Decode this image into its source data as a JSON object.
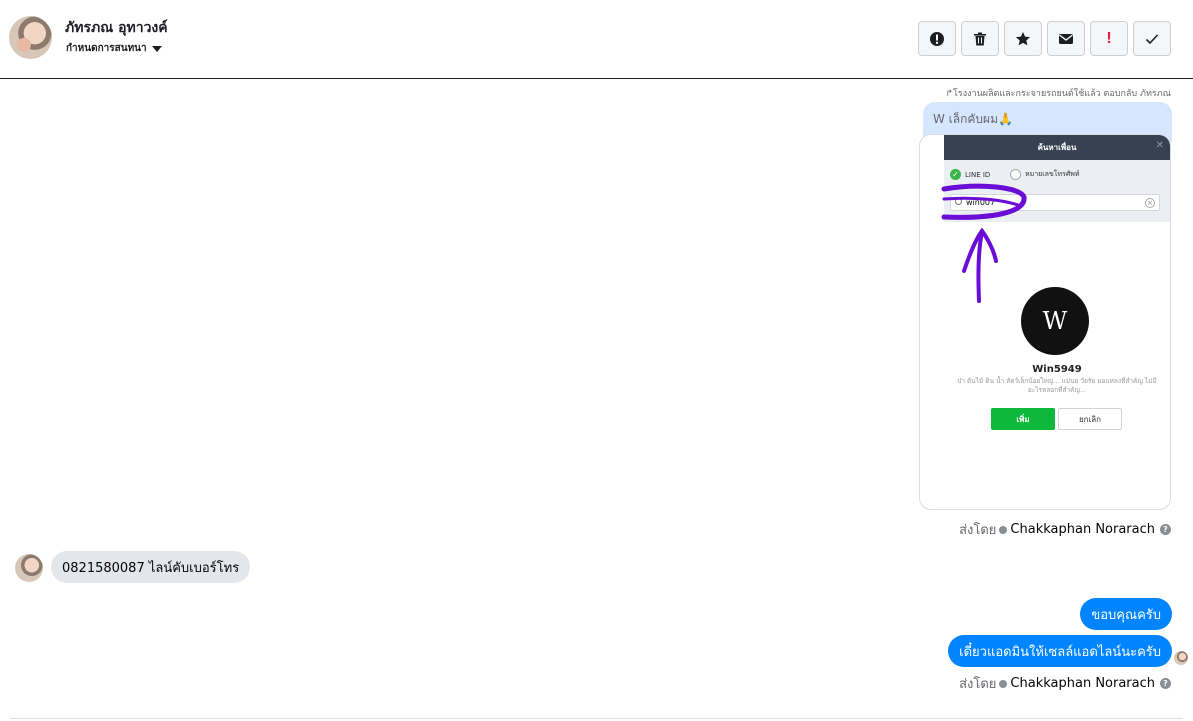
{
  "header": {
    "contact_name": "ภัทรภณ อุทาวงค์",
    "conversation_settings": "กำหนดการสนทนา",
    "toolbar": [
      {
        "name": "report-icon",
        "label": "report"
      },
      {
        "name": "trash-icon",
        "label": "delete"
      },
      {
        "name": "star-icon",
        "label": "star"
      },
      {
        "name": "envelope-icon",
        "label": "mark unread"
      },
      {
        "name": "exclamation-icon",
        "label": "!"
      },
      {
        "name": "checkmark-icon",
        "label": "done"
      }
    ]
  },
  "messages": {
    "reply_reference": "↱โรงงานผลิตและกระจายรถยนต์ใช้แล้ว ตอบกลับ ภัทรภณ",
    "reply_text": "W เล็กคับผม🙏",
    "image": {
      "dialog_title": "ค้นหาเพื่อน",
      "option_line_id": "LINE ID",
      "option_phone": "หมายเลขโทรศัพท์",
      "search_value": "win007",
      "profile_name": "Win5949",
      "profile_desc": "ป่า ต้นไม้ ดิน น้ำ สัตว์เล็กน้อยใหญ่... แม่นย วัยรัย มอแหลงที่สำคัญ ไม่มีอะไรหลอกที่สำคัญ...",
      "add_label": "เพิ่ม",
      "cancel_label": "ยกเลิก",
      "logo_text": "W"
    },
    "sent_by_label": "ส่งโดย",
    "sent_by_name": "Chakkaphan Norarach",
    "help": "?",
    "incoming_text": "0821580087 ไลน์คับเบอร์โทร",
    "outgoing_1": "ขอบคุณครับ",
    "outgoing_2": "เดี๋ยวแอดมินให้เซลล์แอดไลน์นะครับ"
  },
  "colors": {
    "accent": "#0084ff",
    "incoming_bubble": "#e4e6eb",
    "reply_bubble": "#d6e6ff",
    "annotation": "#6a0dd6"
  }
}
